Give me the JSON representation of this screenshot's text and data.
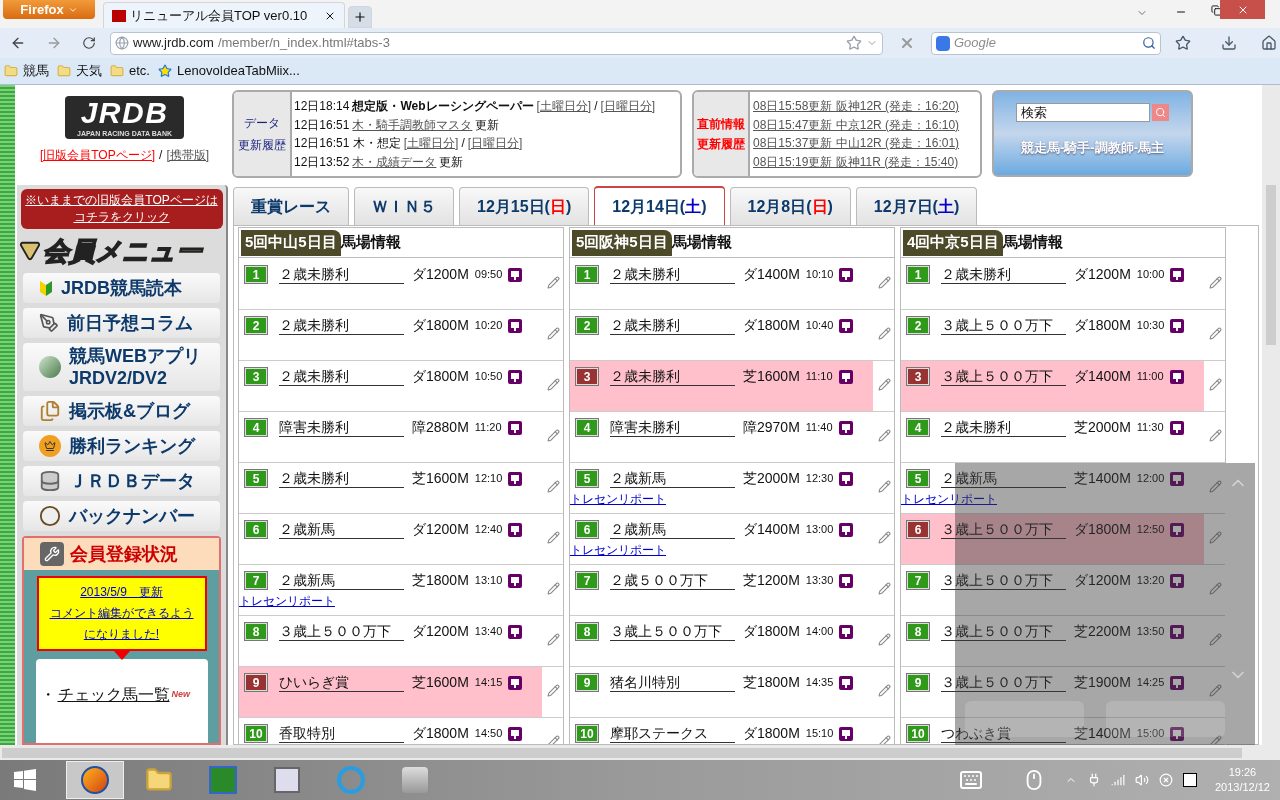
{
  "browser": {
    "menu_button": "Firefox",
    "tab": {
      "title": "リニューアル会員TOP ver0.10"
    },
    "url": {
      "host": "www.jrdb.com",
      "path": "/member/n_index.html#tabs-3"
    },
    "search": {
      "placeholder": "Google"
    },
    "bookmarks": [
      {
        "label": "競馬",
        "kind": "folder"
      },
      {
        "label": "天気",
        "kind": "folder"
      },
      {
        "label": "etc.",
        "kind": "folder"
      },
      {
        "label": "LenovoIdeaTabMiix...",
        "kind": "star"
      }
    ]
  },
  "header": {
    "logo": {
      "title": "JRDB",
      "subtitle": "JAPAN RACING DATA BANK"
    },
    "links": [
      {
        "text": "[旧版会員TOPページ]",
        "kind": "red"
      },
      {
        "text": "/",
        "kind": "plain"
      },
      {
        "text": "[携帯版]",
        "kind": "link"
      }
    ],
    "data_updates": {
      "label_lines": [
        "データ",
        "更新履歴"
      ],
      "entries": [
        [
          {
            "text": "12日18:14",
            "kind": "plain"
          },
          {
            "text": "想定版・Webレーシングペーパー",
            "kind": "bold"
          },
          {
            "text": "[土曜日分]",
            "kind": "link"
          },
          {
            "text": "/",
            "kind": "plain"
          },
          {
            "text": "[日曜日分]",
            "kind": "link"
          }
        ],
        [
          {
            "text": "12日16:51",
            "kind": "plain"
          },
          {
            "text": "木・騎手調教師マスタ",
            "kind": "link"
          },
          {
            "text": "更新",
            "kind": "plain"
          }
        ],
        [
          {
            "text": "12日16:51 木・想定",
            "kind": "plain"
          },
          {
            "text": "[土曜日分]",
            "kind": "link"
          },
          {
            "text": "/",
            "kind": "plain"
          },
          {
            "text": "[日曜日分]",
            "kind": "link"
          }
        ],
        [
          {
            "text": "12日13:52",
            "kind": "plain"
          },
          {
            "text": "木・成績データ",
            "kind": "link"
          },
          {
            "text": "更新",
            "kind": "plain"
          }
        ]
      ]
    },
    "race_updates": {
      "label_lines": [
        "直前情報",
        "更新履歴"
      ],
      "entries": [
        "08日15:58更新 阪神12R (発走：16:20)",
        "08日15:47更新 中京12R (発走：16:10)",
        "08日15:37更新 中山12R (発走：16:01)",
        "08日15:19更新 阪神11R (発走：15:40)"
      ]
    },
    "search": {
      "value": "検索",
      "caption": "競走馬-騎手-調教師-馬主"
    }
  },
  "sidebar": {
    "notice": "※いままでの旧版会員TOPページはコチラをクリック",
    "menu_title": "会員メニュー",
    "items": [
      {
        "label": "JRDB競馬読本",
        "kind": "leaf"
      },
      {
        "label": "前日予想コラム",
        "kind": "pen"
      },
      {
        "label": "競馬WEBアプリ\nJRDV2/DV2",
        "kind": "app"
      },
      {
        "label": "掲示板&ブログ",
        "kind": "docs"
      },
      {
        "label": "勝利ランキング",
        "kind": "crown"
      },
      {
        "label": "ＪＲＤＢデータ",
        "kind": "database"
      },
      {
        "label": "バックナンバー",
        "kind": "clock"
      }
    ],
    "registration": {
      "title": "会員登録状況",
      "notice_lines": [
        "2013/5/9　更新",
        "コメント編集ができるよう",
        "になりました!"
      ],
      "links": [
        {
          "bullet": "・",
          "text": "チェック馬一覧",
          "badge": "New"
        }
      ]
    }
  },
  "tabs": [
    {
      "label": "重賞レース",
      "selected": false
    },
    {
      "label": "ＷＩＮ５",
      "selected": false
    },
    {
      "label": "12月15日(",
      "day": "日",
      "kind": "sunday",
      "suffix": ")",
      "selected": false
    },
    {
      "label": "12月14日(",
      "day": "土",
      "kind": "saturday",
      "suffix": ")",
      "selected": true
    },
    {
      "label": "12月8日(",
      "day": "日",
      "kind": "sunday",
      "suffix": ")",
      "selected": false
    },
    {
      "label": "12月7日(",
      "day": "土",
      "kind": "saturday",
      "suffix": ")",
      "selected": false
    }
  ],
  "columns": [
    {
      "venue": "5回中山5日目",
      "title": "馬場情報",
      "races": [
        {
          "no": "1",
          "name": "２歳未勝利",
          "course": "ダ1200M",
          "time": "09:50",
          "highlighted": false
        },
        {
          "no": "2",
          "name": "２歳未勝利",
          "course": "ダ1800M",
          "time": "10:20",
          "highlighted": false
        },
        {
          "no": "3",
          "name": "２歳未勝利",
          "course": "ダ1800M",
          "time": "10:50",
          "highlighted": false
        },
        {
          "no": "4",
          "name": "障害未勝利",
          "course": "障2880M",
          "time": "11:20",
          "highlighted": false
        },
        {
          "no": "5",
          "name": "２歳未勝利",
          "course": "芝1600M",
          "time": "12:10",
          "highlighted": false
        },
        {
          "no": "6",
          "name": "２歳新馬",
          "course": "ダ1200M",
          "time": "12:40",
          "highlighted": false
        },
        {
          "no": "7",
          "name": "２歳新馬",
          "course": "芝1800M",
          "time": "13:10",
          "highlighted": false,
          "report": "トレセンリポート"
        },
        {
          "no": "8",
          "name": "３歳上５００万下",
          "course": "ダ1200M",
          "time": "13:40",
          "highlighted": false
        },
        {
          "no": "9",
          "name": "ひいらぎ賞",
          "course": "芝1600M",
          "time": "14:15",
          "highlighted": true
        },
        {
          "no": "10",
          "name": "香取特別",
          "course": "ダ1800M",
          "time": "14:50",
          "highlighted": false
        }
      ]
    },
    {
      "venue": "5回阪神5日目",
      "title": "馬場情報",
      "races": [
        {
          "no": "1",
          "name": "２歳未勝利",
          "course": "ダ1400M",
          "time": "10:10",
          "highlighted": false
        },
        {
          "no": "2",
          "name": "２歳未勝利",
          "course": "ダ1800M",
          "time": "10:40",
          "highlighted": false
        },
        {
          "no": "3",
          "name": "２歳未勝利",
          "course": "芝1600M",
          "time": "11:10",
          "highlighted": true
        },
        {
          "no": "4",
          "name": "障害未勝利",
          "course": "障2970M",
          "time": "11:40",
          "highlighted": false
        },
        {
          "no": "5",
          "name": "２歳新馬",
          "course": "芝2000M",
          "time": "12:30",
          "highlighted": false,
          "report": "トレセンリポート"
        },
        {
          "no": "6",
          "name": "２歳新馬",
          "course": "ダ1400M",
          "time": "13:00",
          "highlighted": false,
          "report": "トレセンリポート"
        },
        {
          "no": "7",
          "name": "２歳５００万下",
          "course": "芝1200M",
          "time": "13:30",
          "highlighted": false
        },
        {
          "no": "8",
          "name": "３歳上５００万下",
          "course": "ダ1800M",
          "time": "14:00",
          "highlighted": false
        },
        {
          "no": "9",
          "name": "猪名川特別",
          "course": "芝1800M",
          "time": "14:35",
          "highlighted": false
        },
        {
          "no": "10",
          "name": "摩耶ステークス",
          "course": "ダ1800M",
          "time": "15:10",
          "highlighted": false
        }
      ]
    },
    {
      "venue": "4回中京5日目",
      "title": "馬場情報",
      "races": [
        {
          "no": "1",
          "name": "２歳未勝利",
          "course": "ダ1200M",
          "time": "10:00",
          "highlighted": false
        },
        {
          "no": "2",
          "name": "３歳上５００万下",
          "course": "ダ1800M",
          "time": "10:30",
          "highlighted": false
        },
        {
          "no": "3",
          "name": "３歳上５００万下",
          "course": "ダ1400M",
          "time": "11:00",
          "highlighted": true
        },
        {
          "no": "4",
          "name": "２歳未勝利",
          "course": "芝2000M",
          "time": "11:30",
          "highlighted": false
        },
        {
          "no": "5",
          "name": "２歳新馬",
          "course": "芝1400M",
          "time": "12:00",
          "highlighted": false,
          "report": "トレセンリポート"
        },
        {
          "no": "6",
          "name": "３歳上５００万下",
          "course": "ダ1800M",
          "time": "12:50",
          "highlighted": true
        },
        {
          "no": "7",
          "name": "３歳上５００万下",
          "course": "ダ1200M",
          "time": "13:20",
          "highlighted": false
        },
        {
          "no": "8",
          "name": "３歳上５００万下",
          "course": "芝2200M",
          "time": "13:50",
          "highlighted": false
        },
        {
          "no": "9",
          "name": "３歳上５００万下",
          "course": "芝1900M",
          "time": "14:25",
          "highlighted": false
        },
        {
          "no": "10",
          "name": "つわぶき賞",
          "course": "芝1400M",
          "time": "15:00",
          "highlighted": false
        }
      ]
    }
  ],
  "taskbar": {
    "apps": [
      {
        "kind": "firefox",
        "active": true
      },
      {
        "kind": "folder",
        "active": false
      },
      {
        "kind": "target",
        "active": false
      },
      {
        "kind": "disk",
        "active": false
      },
      {
        "kind": "ie",
        "active": false
      },
      {
        "kind": "j",
        "active": false
      }
    ],
    "clock": {
      "time": "19:26",
      "date": "2013/12/12"
    }
  }
}
